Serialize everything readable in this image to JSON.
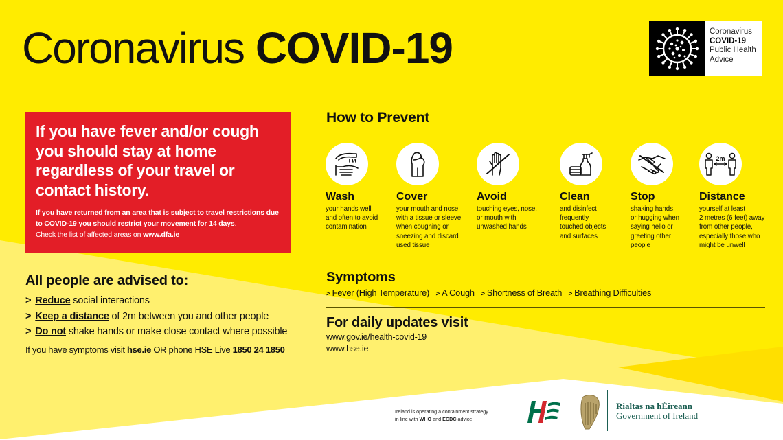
{
  "colors": {
    "yellow": "#ffec00",
    "pale_yellow": "#fff06e",
    "deep_yellow": "#ffdf00",
    "red": "#e31e27",
    "hse_green": "#00704a",
    "hse_red": "#d4272d",
    "gov_green": "#1b5e52"
  },
  "title": {
    "light": "Coronavirus",
    "bold": "COVID-19"
  },
  "badge": {
    "icon": "virus-icon",
    "line1": "Coronavirus",
    "line2": "COVID-19",
    "line3": "Public Health",
    "line4": "Advice"
  },
  "alert": {
    "headline": "If you have fever and/or cough you should stay at home regardless of your travel or contact history.",
    "sub_bold": "If you have returned from an area that is subject to travel restrictions due to COVID-19 you should restrict your movement for 14 days",
    "sub_period": ".",
    "check_text": "Check the list of affected areas on ",
    "check_link": "www.dfa.ie"
  },
  "advice": {
    "heading": "All people are advised to:",
    "items": [
      {
        "emph": "Reduce",
        "rest": " social interactions"
      },
      {
        "emph": "Keep a distance",
        "rest": " of 2m between you and other people"
      },
      {
        "emph": "Do not",
        "rest": " shake hands or make close contact where possible"
      }
    ],
    "chevron": ">",
    "note_prefix": "If you have symptoms visit ",
    "note_link": "hse.ie",
    "note_or": "OR",
    "note_mid": " phone HSE Live ",
    "note_phone": "1850 24 1850"
  },
  "prevent": {
    "heading": "How to Prevent",
    "items": [
      {
        "icon": "hand-washing-icon",
        "label": "Wash",
        "desc": [
          "your hands well",
          "and often to avoid",
          "contamination"
        ]
      },
      {
        "icon": "cough-into-elbow-icon",
        "label": "Cover",
        "desc": [
          "your mouth and nose",
          "with a tissue or sleeve",
          "when coughing or",
          "sneezing and discard",
          "used tissue"
        ]
      },
      {
        "icon": "no-touch-hand-icon",
        "label": "Avoid",
        "desc": [
          "touching eyes, nose,",
          "or mouth with",
          "unwashed hands"
        ]
      },
      {
        "icon": "cleaning-spray-icon",
        "label": "Clean",
        "desc": [
          "and disinfect",
          "frequently",
          "touched objects",
          "and surfaces"
        ]
      },
      {
        "icon": "no-handshake-icon",
        "label": "Stop",
        "desc": [
          "shaking hands",
          "or hugging when",
          "saying hello or",
          "greeting other",
          "people"
        ]
      },
      {
        "icon": "social-distance-icon",
        "label": "Distance",
        "desc": [
          "yourself at least",
          "2 metres (6 feet) away",
          "from other people,",
          "especially those who",
          "might be unwell"
        ],
        "icon_text": "2m"
      }
    ]
  },
  "symptoms": {
    "heading": "Symptoms",
    "items": [
      "Fever (High Temperature)",
      "A Cough",
      "Shortness of Breath",
      "Breathing Difficulties"
    ]
  },
  "updates": {
    "heading": "For daily updates visit",
    "links": [
      "www.gov.ie/health-covid-19",
      "www.hse.ie"
    ]
  },
  "footer": {
    "strategy_line1": "Ireland is operating a containment strategy",
    "strategy_line2_prefix": "in line with ",
    "strategy_who": "WHO",
    "strategy_and": " and ",
    "strategy_ecdc": "ECDC",
    "strategy_suffix": " advice",
    "hse_logo": "HSE",
    "gov_irish": "Rialtas na hÉireann",
    "gov_english": "Government of Ireland"
  }
}
